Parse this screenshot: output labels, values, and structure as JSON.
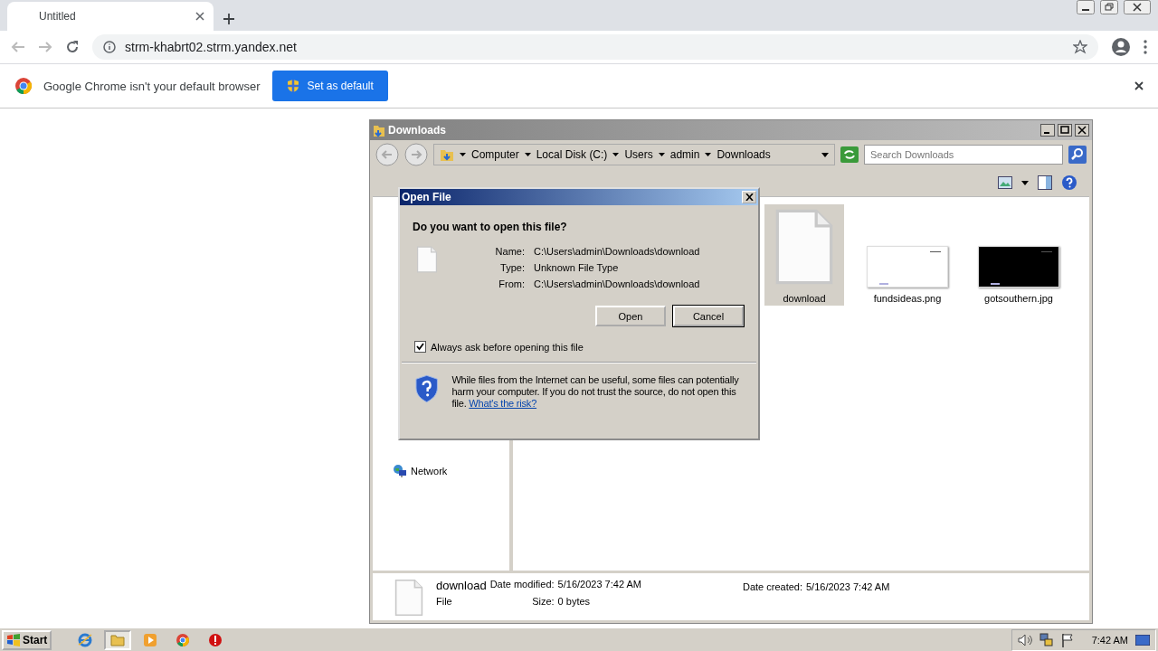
{
  "browser": {
    "tabs": [
      {
        "title": "Untitled",
        "selected": true
      }
    ],
    "address": "strm-khabrt02.strm.yandex.net",
    "infobar": {
      "message": "Google Chrome isn't your default browser",
      "button": "Set as default"
    }
  },
  "explorer": {
    "title": "Downloads",
    "breadcrumb": [
      "Computer",
      "Local Disk (C:)",
      "Users",
      "admin",
      "Downloads"
    ],
    "search": {
      "placeholder": "Search Downloads"
    },
    "sidebar": {
      "items": [
        {
          "label": "Network",
          "selected": false
        }
      ]
    },
    "files": [
      {
        "name": "download",
        "kind": "document",
        "selected": true
      },
      {
        "name": "fundsideas.png",
        "kind": "image",
        "color": "#ffffff",
        "selected": false
      },
      {
        "name": "gotsouthern.jpg",
        "kind": "image",
        "color": "#000000",
        "selected": false
      }
    ],
    "details": {
      "name": "download",
      "type": "File",
      "modified_label": "Date modified:",
      "modified": "5/16/2023 7:42 AM",
      "created_label": "Date created:",
      "created": "5/16/2023 7:42 AM",
      "size_label": "Size:",
      "size": "0 bytes"
    }
  },
  "dialog": {
    "title": "Open File",
    "question": "Do you want to open this file?",
    "fields": [
      {
        "label": "Name:",
        "value": "C:\\Users\\admin\\Downloads\\download"
      },
      {
        "label": "Type:",
        "value": "Unknown File Type"
      },
      {
        "label": "From:",
        "value": "C:\\Users\\admin\\Downloads\\download"
      }
    ],
    "buttons": [
      {
        "label": "Open",
        "default": false
      },
      {
        "label": "Cancel",
        "default": true
      }
    ],
    "always_ask": {
      "label": "Always ask before opening this file",
      "checked": true
    },
    "warning": "While files from the Internet can be useful, some files can potentially harm your computer. If you do not trust the source, do not open this file.",
    "link": "What's the risk?"
  },
  "taskbar": {
    "start": "Start",
    "apps": [
      {
        "kind": "ie",
        "selected": false
      },
      {
        "kind": "folder",
        "selected": true
      },
      {
        "kind": "media",
        "selected": false
      },
      {
        "kind": "chrome",
        "selected": false
      },
      {
        "kind": "stop",
        "selected": false
      }
    ],
    "clock": "7:42 AM"
  }
}
